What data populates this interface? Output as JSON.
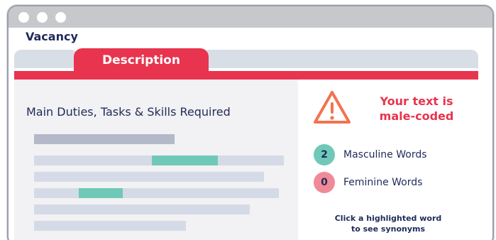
{
  "vacancy_label": "Vacancy",
  "tab": {
    "active_label": "Description"
  },
  "content": {
    "section_title": "Main Duties, Tasks & Skills Required"
  },
  "result": {
    "warning_line1": "Your text is",
    "warning_line2": "male-coded",
    "masculine": {
      "count": "2",
      "label": "Masculine Words"
    },
    "feminine": {
      "count": "0",
      "label": "Feminine Words"
    },
    "hint_line1": "Click a highlighted word",
    "hint_line2": "to see synonyms"
  },
  "colors": {
    "accent": "#e8344e",
    "highlight": "#6fc9b6",
    "feminine_badge": "#f08a97",
    "warning_icon": "#f2734f",
    "text": "#1f2a5a"
  },
  "icons": [
    "warning-icon"
  ]
}
